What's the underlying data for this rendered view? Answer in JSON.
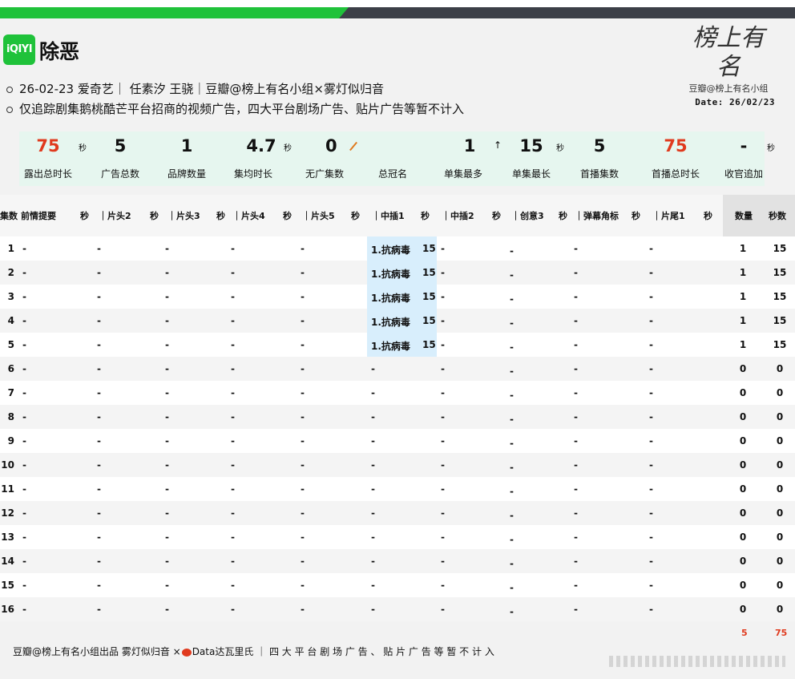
{
  "header": {
    "logo_text": "iQIYI",
    "title": "除恶",
    "info_line1": "26-02-23 爱奇艺｜ 任素汐 王骁｜豆瓣@榜上有名小组×雾灯似归音",
    "info_line2": "仅追踪剧集鹅桃酷芒平台招商的视频广告，四大平台剧场广告、贴片广告等暂不计入",
    "date": "Date: 26/02/23",
    "stamp_art": "榜上有名",
    "stamp_text": "豆瓣@榜上有名小组"
  },
  "summary": [
    {
      "value": "75",
      "label": "露出总时长",
      "color": "#e03a1e"
    },
    {
      "value": "5",
      "label": "广告总数",
      "color": "#111111"
    },
    {
      "value": "1",
      "label": "品牌数量",
      "color": "#111111"
    },
    {
      "value": "4.7",
      "label": "集均时长",
      "color": "#111111"
    },
    {
      "value": "0",
      "label": "无广集数",
      "color": "#111111"
    },
    {
      "value": "",
      "label": "总冠名",
      "color": "#111111"
    },
    {
      "value": "1",
      "label": "单集最多",
      "color": "#111111"
    },
    {
      "value": "15",
      "label": "单集最长",
      "color": "#111111"
    },
    {
      "value": "5",
      "label": "首播集数",
      "color": "#111111"
    },
    {
      "value": "75",
      "label": "首播总时长",
      "color": "#e03a1e"
    },
    {
      "value": "-",
      "label": "收官追加",
      "color": "#111111"
    }
  ],
  "units": {
    "sec": "秒",
    "up": "↑"
  },
  "columns": [
    "集数",
    "前情提要",
    "秒",
    "｜片头2",
    "秒",
    "｜片头3",
    "秒",
    "｜片头4",
    "秒",
    "｜片头5",
    "秒",
    "｜中插1",
    "秒",
    "｜中插2",
    "秒",
    "｜创意3",
    "秒",
    "｜弹幕角标",
    "秒",
    "｜片尾1",
    "秒",
    "数量",
    "秒数"
  ],
  "rows": [
    {
      "ep": "1",
      "midroll1": "1.抗病毒",
      "midroll1_sec": "15",
      "count": "1",
      "secs": "15"
    },
    {
      "ep": "2",
      "midroll1": "1.抗病毒",
      "midroll1_sec": "15",
      "count": "1",
      "secs": "15"
    },
    {
      "ep": "3",
      "midroll1": "1.抗病毒",
      "midroll1_sec": "15",
      "count": "1",
      "secs": "15"
    },
    {
      "ep": "4",
      "midroll1": "1.抗病毒",
      "midroll1_sec": "15",
      "count": "1",
      "secs": "15"
    },
    {
      "ep": "5",
      "midroll1": "1.抗病毒",
      "midroll1_sec": "15",
      "count": "1",
      "secs": "15"
    },
    {
      "ep": "6",
      "midroll1": "-",
      "midroll1_sec": "",
      "count": "0",
      "secs": "0"
    },
    {
      "ep": "7",
      "midroll1": "-",
      "midroll1_sec": "",
      "count": "0",
      "secs": "0"
    },
    {
      "ep": "8",
      "midroll1": "-",
      "midroll1_sec": "",
      "count": "0",
      "secs": "0"
    },
    {
      "ep": "9",
      "midroll1": "-",
      "midroll1_sec": "",
      "count": "0",
      "secs": "0"
    },
    {
      "ep": "10",
      "midroll1": "-",
      "midroll1_sec": "",
      "count": "0",
      "secs": "0"
    },
    {
      "ep": "11",
      "midroll1": "-",
      "midroll1_sec": "",
      "count": "0",
      "secs": "0"
    },
    {
      "ep": "12",
      "midroll1": "-",
      "midroll1_sec": "",
      "count": "0",
      "secs": "0"
    },
    {
      "ep": "13",
      "midroll1": "-",
      "midroll1_sec": "",
      "count": "0",
      "secs": "0"
    },
    {
      "ep": "14",
      "midroll1": "-",
      "midroll1_sec": "",
      "count": "0",
      "secs": "0"
    },
    {
      "ep": "15",
      "midroll1": "-",
      "midroll1_sec": "",
      "count": "0",
      "secs": "0"
    },
    {
      "ep": "16",
      "midroll1": "-",
      "midroll1_sec": "",
      "count": "0",
      "secs": "0"
    }
  ],
  "empty_cell": "-",
  "totals": {
    "count": "5",
    "secs": "75"
  },
  "footer": {
    "left": "豆瓣@榜上有名小组出品  雾灯似归音 ×",
    "right": "Data达瓦里氏 ｜ 四 大 平 台 剧 场 广 告 、 贴 片 广 告 等 暂 不 计 入"
  }
}
